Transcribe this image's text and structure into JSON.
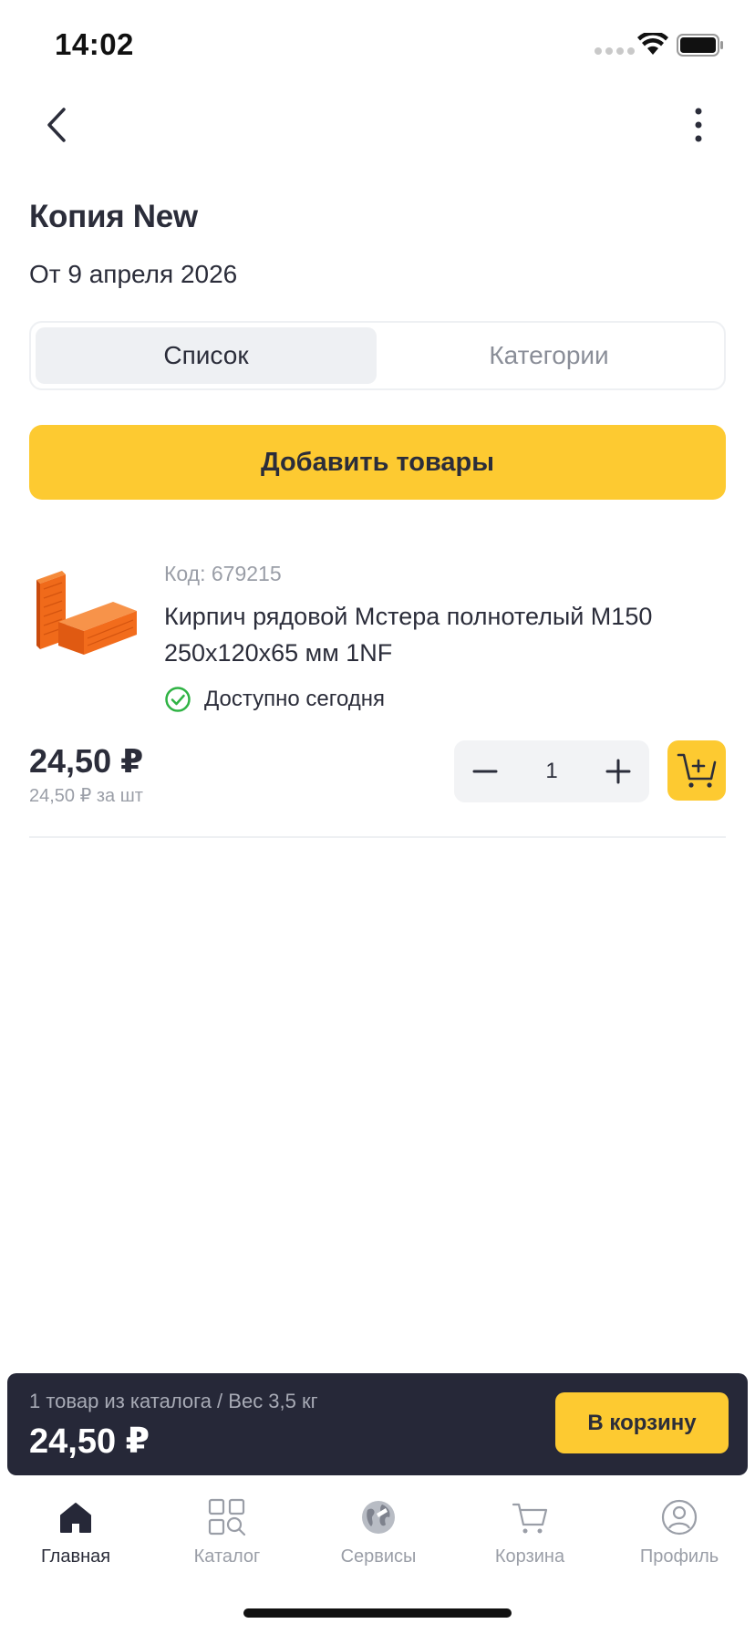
{
  "status_bar": {
    "time": "14:02"
  },
  "header": {
    "back_icon": "chevron-left-icon",
    "more_icon": "more-vertical-icon"
  },
  "page": {
    "title": "Копия New",
    "date": "От 9 апреля 2026"
  },
  "segmented": {
    "tabs": [
      {
        "label": "Список",
        "active": true
      },
      {
        "label": "Категории",
        "active": false
      }
    ]
  },
  "actions": {
    "add_goods_label": "Добавить товары"
  },
  "product": {
    "image": "brick-image",
    "code": "Код: 679215",
    "name": "Кирпич рядовой Мстера полнотелый М150 250х120х65 мм 1NF",
    "availability": "Доступно сегодня",
    "price": "24,50 ₽",
    "unit_price": "24,50 ₽ за шт",
    "quantity": "1"
  },
  "summary": {
    "info": "1 товар из каталога / Вес 3,5 кг",
    "total": "24,50 ₽",
    "to_cart_label": "В корзину"
  },
  "tab_bar": {
    "items": [
      {
        "label": "Главная",
        "icon": "home-icon",
        "active": true
      },
      {
        "label": "Каталог",
        "icon": "catalog-search-icon",
        "active": false
      },
      {
        "label": "Сервисы",
        "icon": "services-globe-icon",
        "active": false
      },
      {
        "label": "Корзина",
        "icon": "cart-icon",
        "active": false
      },
      {
        "label": "Профиль",
        "icon": "profile-icon",
        "active": false
      }
    ]
  },
  "colors": {
    "accent": "#fdca31",
    "dark": "#262838",
    "text": "#2b2d3a",
    "muted": "#9a9ea7",
    "success": "#2fb344",
    "brick": "#f06a1a"
  }
}
